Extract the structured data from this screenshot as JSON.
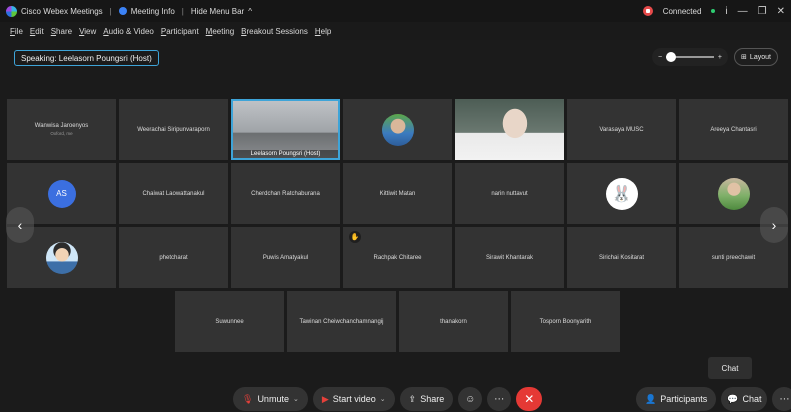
{
  "titlebar": {
    "app_name": "Cisco Webex Meetings",
    "meeting_info": "Meeting Info",
    "hide_menu": "Hide Menu Bar",
    "status": "Connected"
  },
  "menu": [
    "File",
    "Edit",
    "Share",
    "View",
    "Audio & Video",
    "Participant",
    "Meeting",
    "Breakout Sessions",
    "Help"
  ],
  "speaking": "Speaking: Leelasorn Poungsri (Host)",
  "layout_label": "Layout",
  "participants": {
    "row1": [
      {
        "name": "Wanwisa Jaroenyos",
        "sub": "Oxford, me"
      },
      {
        "name": "Weerachai Siripunvaraporn"
      },
      {
        "name": "Leelasorn Poungsri  (Host)",
        "video": "room"
      },
      {
        "name": "",
        "avatar": "photo-blue"
      },
      {
        "name": "",
        "video": "person"
      },
      {
        "name": "Varasaya MUSC"
      },
      {
        "name": "Areeya Chantasri"
      }
    ],
    "row2": [
      {
        "name": "",
        "initials": "AS"
      },
      {
        "name": "Chaiwat Laowattanakul"
      },
      {
        "name": "Cherdchan Ratchaburana"
      },
      {
        "name": "Kittiwit Matan"
      },
      {
        "name": "narin nuttavut"
      },
      {
        "name": "",
        "avatar": "bunny"
      },
      {
        "name": "",
        "avatar": "photo-green"
      }
    ],
    "row3": [
      {
        "name": "",
        "avatar": "cartoon"
      },
      {
        "name": "phetcharat"
      },
      {
        "name": "Puwis Amatyakul"
      },
      {
        "name": "Rachpak Chitaree"
      },
      {
        "name": "Sirawit Khantarak"
      },
      {
        "name": "Sirichai Kositarat"
      },
      {
        "name": "sunti preechawit"
      }
    ],
    "row4": [
      {
        "name": "Suwunnee"
      },
      {
        "name": "Tawinan Cheiwchanchamnangij"
      },
      {
        "name": "thanakorn"
      },
      {
        "name": "Tosporn Boonyarith"
      }
    ]
  },
  "tooltip": "Chat",
  "controls": {
    "unmute": "Unmute",
    "start_video": "Start video",
    "share": "Share",
    "participants": "Participants",
    "chat": "Chat"
  },
  "colors": {
    "accent": "#3ea4d8",
    "end_call": "#e53935",
    "tile_bg": "#333333"
  }
}
